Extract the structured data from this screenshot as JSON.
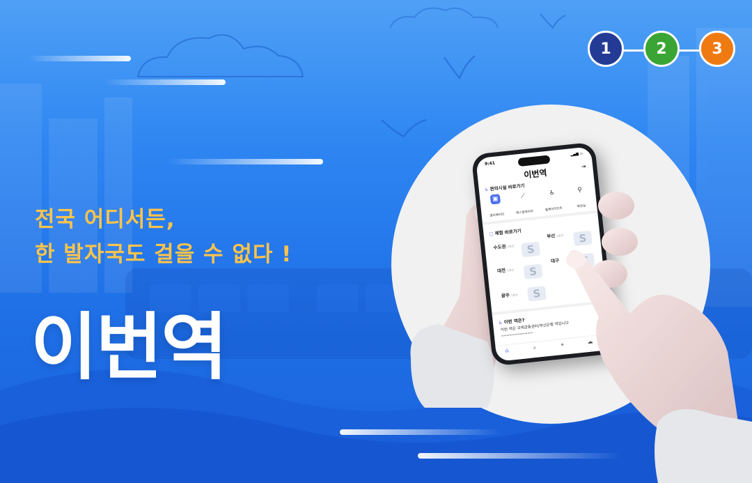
{
  "steps": {
    "items": [
      {
        "label": "1",
        "color": "#243b96"
      },
      {
        "label": "2",
        "color": "#3aa534"
      },
      {
        "label": "3",
        "color": "#f07a12"
      }
    ]
  },
  "headline": {
    "line1": "전국 어디서든,",
    "line2": "한 발자국도 걸을 수 없다 !",
    "color": "#ffc44a"
  },
  "app_name": "이번역",
  "phone": {
    "time": "9:41",
    "title": "이번역",
    "facility_section": "편의시설 바로가기",
    "facilities": [
      {
        "label": "엘리베이터",
        "icon": "elevator-icon"
      },
      {
        "label": "에스컬레이터",
        "icon": "escalator-icon"
      },
      {
        "label": "휠체어리프트",
        "icon": "wheelchair-lift-icon"
      },
      {
        "label": "화장실",
        "icon": "restroom-icon"
      }
    ],
    "route_section": "체험 바로가기",
    "regions": [
      {
        "name": "수도권",
        "count": "1호선"
      },
      {
        "name": "부산",
        "count": "1호선"
      },
      {
        "name": "대전",
        "count": "1호선"
      },
      {
        "name": "대구",
        "count": ""
      },
      {
        "name": "광주",
        "count": "1호선"
      }
    ],
    "station_section": "이번 역은?",
    "station_text": "이번 역은 국제금융센터/부산은행 역입니다",
    "tabs": [
      {
        "label": "홈",
        "icon": "home-icon"
      },
      {
        "label": "검색",
        "icon": "search-icon"
      },
      {
        "label": "위치",
        "icon": "location-icon"
      },
      {
        "label": "채팅",
        "icon": "chat-icon"
      }
    ]
  }
}
